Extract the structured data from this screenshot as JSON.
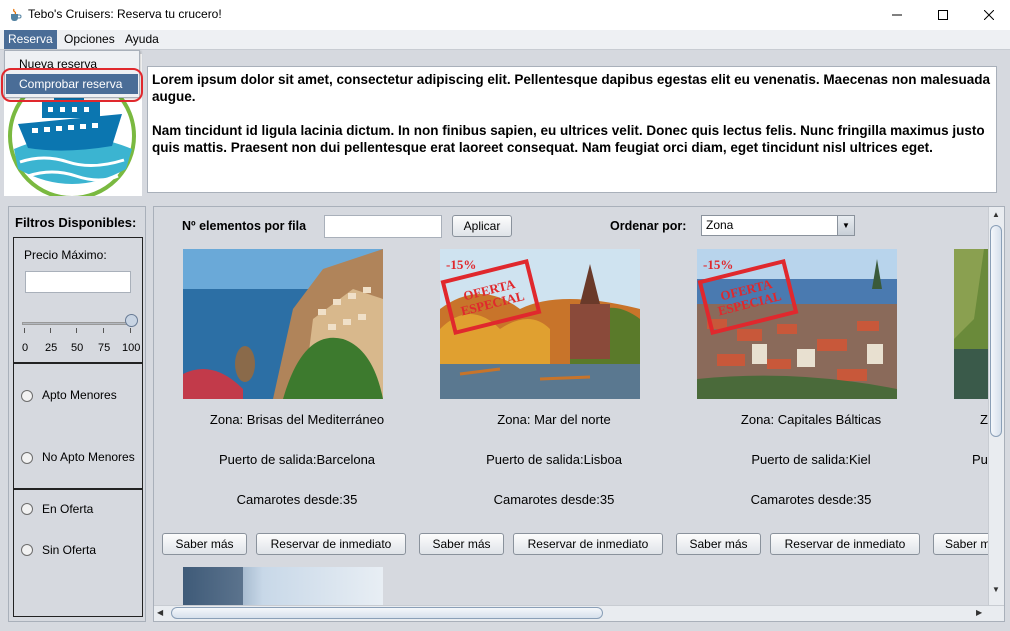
{
  "window": {
    "title": "Tebo's Cruisers: Reserva tu crucero!",
    "minimize_icon": "minimize-icon",
    "maximize_icon": "maximize-icon",
    "close_icon": "close-icon"
  },
  "menubar": {
    "items": [
      {
        "label": "Reserva",
        "active": true
      },
      {
        "label": "Opciones"
      },
      {
        "label": "Ayuda"
      }
    ]
  },
  "reserva_menu": {
    "items": [
      {
        "label": "Nueva reserva"
      },
      {
        "label": "Comprobar reserva",
        "selected": true
      }
    ]
  },
  "description": {
    "paragraph1": "Lorem ipsum dolor sit amet, consectetur adipiscing elit. Pellentesque dapibus egestas elit eu venenatis. Maecenas non malesuada augue.",
    "paragraph2": "Nam tincidunt id ligula lacinia dictum. In non finibus sapien, eu ultrices velit. Donec quis lectus felis. Nunc fringilla maximus justo quis mattis. Praesent non dui pellentesque erat laoreet consequat. Nam feugiat orci diam, eget tincidunt nisl ultrices eget."
  },
  "filters": {
    "title": "Filtros Disponibles:",
    "price_label": "Precio Máximo:",
    "price_value": "",
    "slider": {
      "min": 0,
      "max": 100,
      "value": 100,
      "ticks": [
        "0",
        "25",
        "50",
        "75",
        "100"
      ]
    },
    "minors": [
      {
        "label": "Apto Menores",
        "checked": false
      },
      {
        "label": "No Apto Menores",
        "checked": false
      }
    ],
    "offer": [
      {
        "label": "En Oferta",
        "checked": false
      },
      {
        "label": "Sin Oferta",
        "checked": false
      }
    ]
  },
  "controls": {
    "per_row_label": "Nº elementos por fila",
    "per_row_value": "",
    "apply_label": "Aplicar",
    "sort_label": "Ordenar por:",
    "sort_value": "Zona"
  },
  "cards": [
    {
      "zona": "Zona: Brisas del Mediterráneo",
      "puerto": "Puerto de salida:Barcelona",
      "camarotes": "Camarotes desde:35",
      "offer": false,
      "more": "Saber más",
      "book": "Reservar de inmediato"
    },
    {
      "zona": "Zona: Mar del norte",
      "puerto": "Puerto de salida:Lisboa",
      "camarotes": "Camarotes desde:35",
      "offer": true,
      "discount": "-15%",
      "stamp": "OFERTA ESPECIAL",
      "more": "Saber más",
      "book": "Reservar de inmediato"
    },
    {
      "zona": "Zona: Capitales Bálticas",
      "puerto": "Puerto de salida:Kiel",
      "camarotes": "Camarotes desde:35",
      "offer": true,
      "discount": "-15%",
      "stamp": "OFERTA ESPECIAL",
      "more": "Saber más",
      "book": "Reservar de inmediato"
    },
    {
      "zona": "Zona",
      "puerto": "Puer",
      "camarotes": "",
      "offer": false,
      "more": "Saber más",
      "book": ""
    }
  ],
  "colors": {
    "accent": "#4a6d97",
    "highlight_ring": "#e0282d",
    "logo_blue": "#0d8fbf",
    "logo_green": "#7ab940"
  }
}
